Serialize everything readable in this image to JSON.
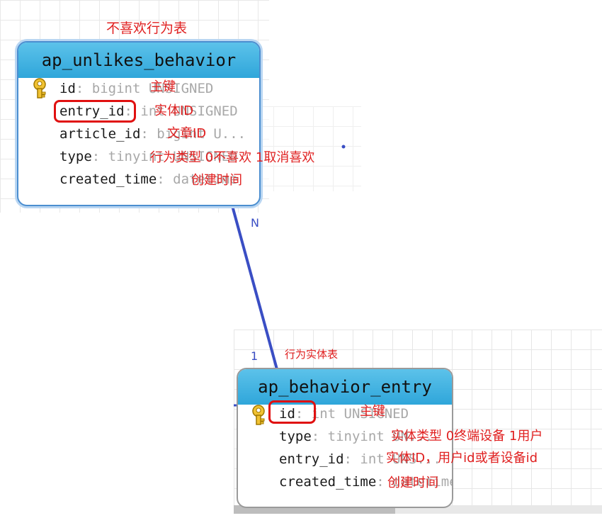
{
  "labels": {
    "unlikes_table": "不喜欢行为表",
    "entry_table": "行为实体表"
  },
  "tables": {
    "unlikes": {
      "name": "ap_unlikes_behavior",
      "columns": [
        {
          "name": "id",
          "type": "bigint UNSIGNED",
          "key": true
        },
        {
          "name": "entry_id",
          "type": "int UNSIGNED",
          "key": false
        },
        {
          "name": "article_id",
          "type": "bigint U...",
          "key": false
        },
        {
          "name": "type",
          "type": "tinyint UNSIGNED",
          "key": false
        },
        {
          "name": "created_time",
          "type": "datetime",
          "key": false
        }
      ],
      "annotations": [
        "主键",
        "实体ID",
        "文章ID",
        "行为类型 0不喜欢 1取消喜欢",
        "创建时间"
      ]
    },
    "entry": {
      "name": "ap_behavior_entry",
      "columns": [
        {
          "name": "id",
          "type": "int UNSIGNED",
          "key": true
        },
        {
          "name": "type",
          "type": "tinyint UN...",
          "key": false
        },
        {
          "name": "entry_id",
          "type": "int UNS...",
          "key": false
        },
        {
          "name": "created_time",
          "type": "datetime",
          "key": false
        }
      ],
      "annotations": [
        "主键",
        "实体类型 0终端设备 1用户",
        "实体ID，用户id或者设备id",
        "创建时间"
      ]
    }
  },
  "relation": {
    "many_label": "N",
    "one_label": "1"
  },
  "colors": {
    "annotation": "#e02020",
    "relation_line": "#3a4ec4",
    "header": "#2fa6da",
    "highlight": "#e01010"
  },
  "icons": [
    "key-icon"
  ]
}
